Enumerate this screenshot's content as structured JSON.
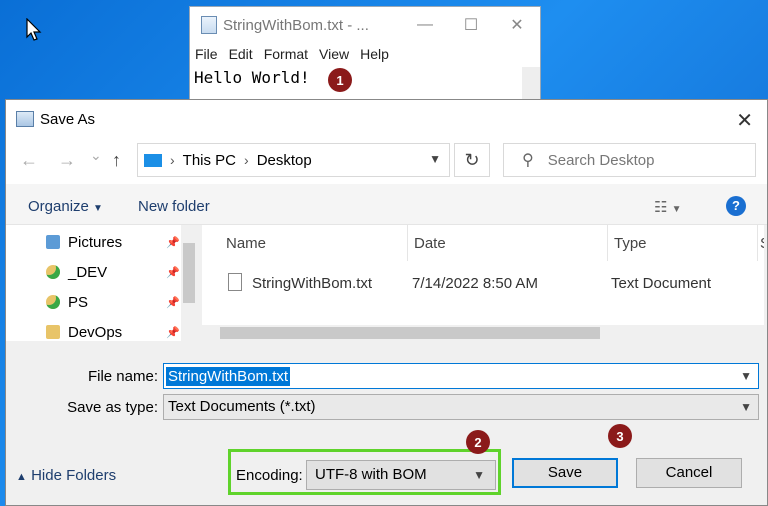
{
  "notepad": {
    "title": "StringWithBom.txt - ...",
    "controls": {
      "minimize": "—",
      "maximize": "☐",
      "close": "✕"
    },
    "menu": [
      "File",
      "Edit",
      "Format",
      "View",
      "Help"
    ],
    "content": "Hello World!"
  },
  "badges": [
    "1",
    "2",
    "3"
  ],
  "dialog": {
    "title": "Save As",
    "close": "✕",
    "nav": {
      "back": "←",
      "forward": "→",
      "recent": "⌄",
      "up": "↑",
      "refresh": "↻"
    },
    "breadcrumb": [
      "This PC",
      "Desktop"
    ],
    "breadcrumb_sep": "›",
    "search_placeholder": "Search Desktop",
    "toolbar": {
      "organize": "Organize",
      "new_folder": "New folder",
      "help": "?"
    },
    "tree": [
      {
        "label": "Pictures"
      },
      {
        "label": "_DEV"
      },
      {
        "label": "PS"
      },
      {
        "label": "DevOps"
      }
    ],
    "columns": [
      "Name",
      "Date",
      "Type",
      "S"
    ],
    "files": [
      {
        "name": "StringWithBom.txt",
        "date": "7/14/2022 8:50 AM",
        "type": "Text Document"
      }
    ],
    "file_name_label": "File name:",
    "file_name_value": "StringWithBom.txt",
    "save_type_label": "Save as type:",
    "save_type_value": "Text Documents (*.txt)",
    "hide_folders": "Hide Folders",
    "encoding_label": "Encoding:",
    "encoding_value": "UTF-8 with BOM",
    "save": "Save",
    "cancel": "Cancel"
  },
  "colors": {
    "accent": "#0078d7",
    "highlight": "#5fd32b",
    "badge": "#8b1a1a"
  }
}
